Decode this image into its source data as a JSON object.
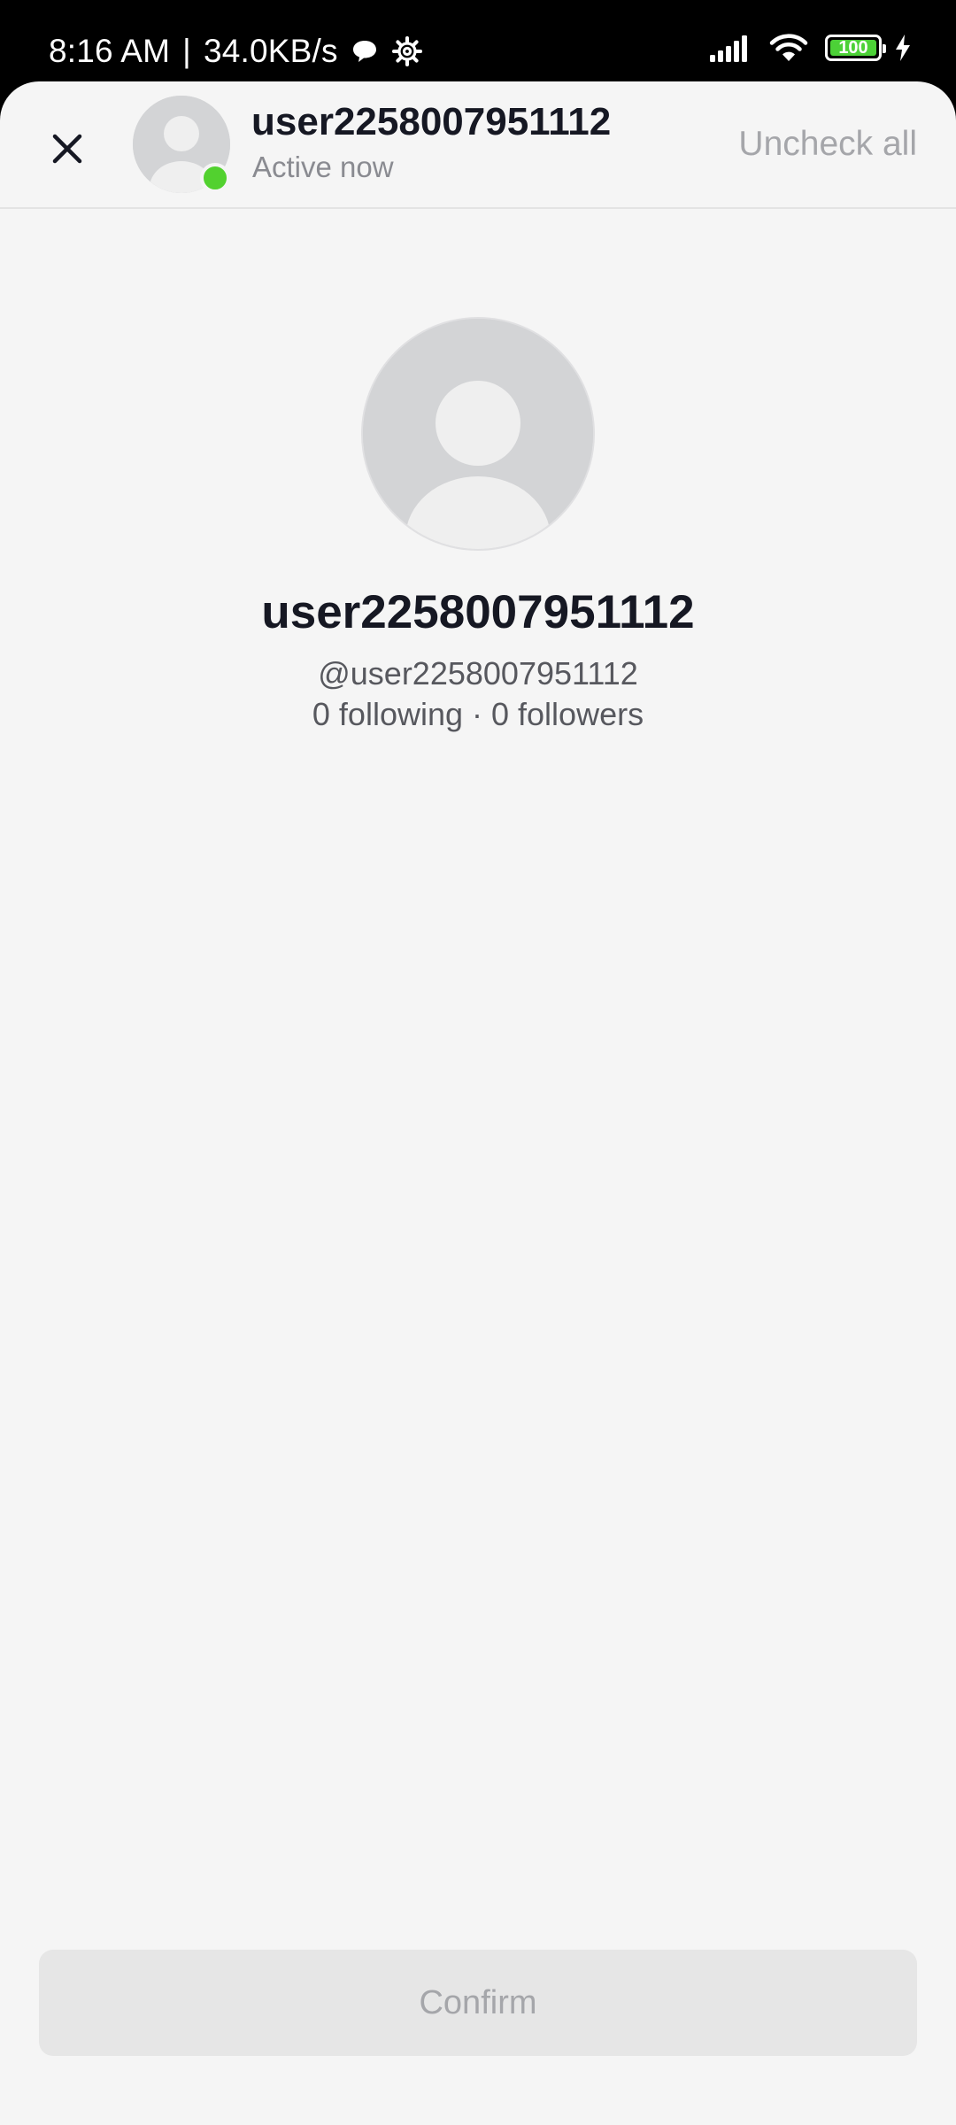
{
  "status_bar": {
    "time": "8:16 AM",
    "separator": "|",
    "network_speed": "34.0KB/s",
    "icons": [
      "chat-bubble-icon",
      "settings-gear-icon",
      "signal-icon",
      "wifi-icon",
      "battery-icon",
      "charging-bolt-icon"
    ],
    "battery_level": "100",
    "battery_fraction": 1.0
  },
  "header": {
    "close_icon": "close-icon",
    "name": "user2258007951112",
    "status": "Active now",
    "uncheck_all_label": "Uncheck all"
  },
  "profile": {
    "name": "user2258007951112",
    "handle": "@user2258007951112",
    "stats": "0 following · 0 followers"
  },
  "footer": {
    "confirm_label": "Confirm"
  },
  "colors": {
    "online": "#52d12f",
    "battery_fill": "#4cd137",
    "text_primary": "#161823",
    "text_muted": "#a5a6aa",
    "sheet_background": "#f5f5f5"
  }
}
